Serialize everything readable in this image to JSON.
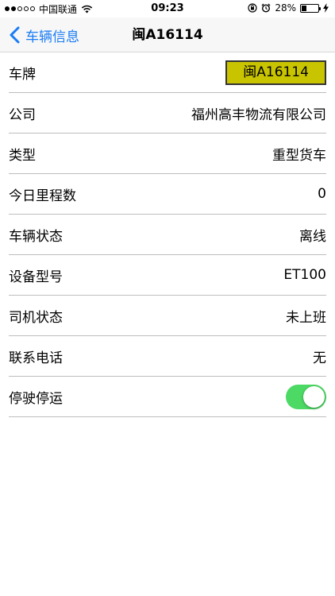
{
  "status_bar": {
    "carrier": "中国联通",
    "time": "09:23",
    "battery": "28%",
    "battery_level": 0.28
  },
  "nav": {
    "back_label": "车辆信息",
    "title": "闽A16114"
  },
  "rows": [
    {
      "label": "车牌",
      "value": "闽A16114"
    },
    {
      "label": "公司",
      "value": "福州高丰物流有限公司"
    },
    {
      "label": "类型",
      "value": "重型货车"
    },
    {
      "label": "今日里程数",
      "value": "0"
    },
    {
      "label": "车辆状态",
      "value": "离线"
    },
    {
      "label": "设备型号",
      "value": "ET100"
    },
    {
      "label": "司机状态",
      "value": "未上班"
    },
    {
      "label": "联系电话",
      "value": "无"
    },
    {
      "label": "停驶停运",
      "toggle_on": true
    }
  ],
  "colors": {
    "accent": "#1a7cf5",
    "plate_bg": "#c9c400",
    "toggle_on": "#4cd964"
  },
  "icons": [
    "cellular-signal-icon",
    "wifi-icon",
    "rotation-lock-icon",
    "alarm-icon",
    "battery-icon",
    "charging-bolt-icon",
    "chevron-left-icon"
  ]
}
